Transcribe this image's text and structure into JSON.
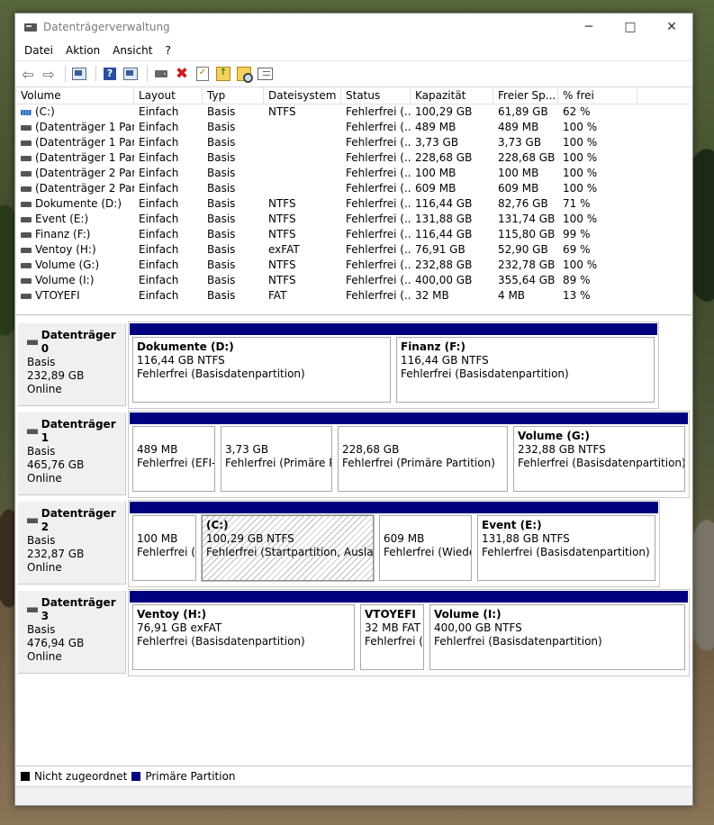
{
  "window": {
    "title": "Datenträgerverwaltung"
  },
  "menu": [
    "Datei",
    "Aktion",
    "Ansicht",
    "?"
  ],
  "toolbar_icons": [
    "back-arrow-icon",
    "forward-arrow-icon",
    "console-tree-icon",
    "help-icon",
    "properties-icon",
    "connect-drive-icon",
    "delete-icon",
    "check-icon",
    "up-folder-icon",
    "search-folder-icon",
    "list-view-icon"
  ],
  "volume_list": {
    "headers": [
      "Volume",
      "Layout",
      "Typ",
      "Dateisystem",
      "Status",
      "Kapazität",
      "Freier Sp...",
      "% frei"
    ],
    "rows": [
      {
        "volume": "(C:)",
        "layout": "Einfach",
        "typ": "Basis",
        "fs": "NTFS",
        "status": "Fehlerfrei (...",
        "cap": "100,29 GB",
        "free": "61,89 GB",
        "pct": "62 %",
        "sys": true
      },
      {
        "volume": "(Datenträger 1 Par...",
        "layout": "Einfach",
        "typ": "Basis",
        "fs": "",
        "status": "Fehlerfrei (...",
        "cap": "489 MB",
        "free": "489 MB",
        "pct": "100 %"
      },
      {
        "volume": "(Datenträger 1 Par...",
        "layout": "Einfach",
        "typ": "Basis",
        "fs": "",
        "status": "Fehlerfrei (...",
        "cap": "3,73 GB",
        "free": "3,73 GB",
        "pct": "100 %"
      },
      {
        "volume": "(Datenträger 1 Par...",
        "layout": "Einfach",
        "typ": "Basis",
        "fs": "",
        "status": "Fehlerfrei (...",
        "cap": "228,68 GB",
        "free": "228,68 GB",
        "pct": "100 %"
      },
      {
        "volume": "(Datenträger 2 Par...",
        "layout": "Einfach",
        "typ": "Basis",
        "fs": "",
        "status": "Fehlerfrei (...",
        "cap": "100 MB",
        "free": "100 MB",
        "pct": "100 %"
      },
      {
        "volume": "(Datenträger 2 Par...",
        "layout": "Einfach",
        "typ": "Basis",
        "fs": "",
        "status": "Fehlerfrei (...",
        "cap": "609 MB",
        "free": "609 MB",
        "pct": "100 %"
      },
      {
        "volume": "Dokumente (D:)",
        "layout": "Einfach",
        "typ": "Basis",
        "fs": "NTFS",
        "status": "Fehlerfrei (...",
        "cap": "116,44 GB",
        "free": "82,76 GB",
        "pct": "71 %"
      },
      {
        "volume": "Event (E:)",
        "layout": "Einfach",
        "typ": "Basis",
        "fs": "NTFS",
        "status": "Fehlerfrei (...",
        "cap": "131,88 GB",
        "free": "131,74 GB",
        "pct": "100 %"
      },
      {
        "volume": "Finanz (F:)",
        "layout": "Einfach",
        "typ": "Basis",
        "fs": "NTFS",
        "status": "Fehlerfrei (...",
        "cap": "116,44 GB",
        "free": "115,80 GB",
        "pct": "99 %"
      },
      {
        "volume": "Ventoy (H:)",
        "layout": "Einfach",
        "typ": "Basis",
        "fs": "exFAT",
        "status": "Fehlerfrei (...",
        "cap": "76,91 GB",
        "free": "52,90 GB",
        "pct": "69 %"
      },
      {
        "volume": "Volume (G:)",
        "layout": "Einfach",
        "typ": "Basis",
        "fs": "NTFS",
        "status": "Fehlerfrei (...",
        "cap": "232,88 GB",
        "free": "232,78 GB",
        "pct": "100 %"
      },
      {
        "volume": "Volume (I:)",
        "layout": "Einfach",
        "typ": "Basis",
        "fs": "NTFS",
        "status": "Fehlerfrei (...",
        "cap": "400,00 GB",
        "free": "355,64 GB",
        "pct": "89 %"
      },
      {
        "volume": "VTOYEFI",
        "layout": "Einfach",
        "typ": "Basis",
        "fs": "FAT",
        "status": "Fehlerfrei (...",
        "cap": "32 MB",
        "free": "4 MB",
        "pct": "13 %"
      }
    ]
  },
  "disks": [
    {
      "name": "Datenträger 0",
      "type": "Basis",
      "size": "232,89 GB",
      "state": "Online",
      "partitions": [
        {
          "name": "Dokumente  (D:)",
          "line2": "116,44 GB NTFS",
          "line3": "Fehlerfrei (Basisdatenpartition)"
        },
        {
          "name": "Finanz  (F:)",
          "line2": "116,44 GB NTFS",
          "line3": "Fehlerfrei (Basisdatenpartition)"
        }
      ]
    },
    {
      "name": "Datenträger 1",
      "type": "Basis",
      "size": "465,76 GB",
      "state": "Online",
      "partitions": [
        {
          "name": "",
          "line2": "489 MB",
          "line3": "Fehlerfrei (EFI-S"
        },
        {
          "name": "",
          "line2": "3,73 GB",
          "line3": "Fehlerfrei (Primäre Pa"
        },
        {
          "name": "",
          "line2": "228,68 GB",
          "line3": "Fehlerfrei (Primäre Partition)"
        },
        {
          "name": "Volume  (G:)",
          "line2": "232,88 GB NTFS",
          "line3": "Fehlerfrei (Basisdatenpartition)"
        }
      ]
    },
    {
      "name": "Datenträger 2",
      "type": "Basis",
      "size": "232,87 GB",
      "state": "Online",
      "partitions": [
        {
          "name": "",
          "line2": "100 MB",
          "line3": "Fehlerfrei (E"
        },
        {
          "name": "(C:)",
          "line2": "100,29 GB NTFS",
          "line3": "Fehlerfrei (Startpartition, Auslageru"
        },
        {
          "name": "",
          "line2": "609 MB",
          "line3": "Fehlerfrei (Wieder"
        },
        {
          "name": "Event  (E:)",
          "line2": "131,88 GB NTFS",
          "line3": "Fehlerfrei (Basisdatenpartition)"
        }
      ]
    },
    {
      "name": "Datenträger 3",
      "type": "Basis",
      "size": "476,94 GB",
      "state": "Online",
      "partitions": [
        {
          "name": "Ventoy  (H:)",
          "line2": "76,91 GB exFAT",
          "line3": "Fehlerfrei (Basisdatenpartition)"
        },
        {
          "name": "VTOYEFI",
          "line2": "32 MB FAT",
          "line3": "Fehlerfrei (B"
        },
        {
          "name": "Volume  (I:)",
          "line2": "400,00 GB NTFS",
          "line3": "Fehlerfrei (Basisdatenpartition)"
        }
      ]
    }
  ],
  "legend": [
    {
      "label": "Nicht zugeordnet",
      "color": "#000000"
    },
    {
      "label": "Primäre Partition",
      "color": "#00007f"
    }
  ]
}
